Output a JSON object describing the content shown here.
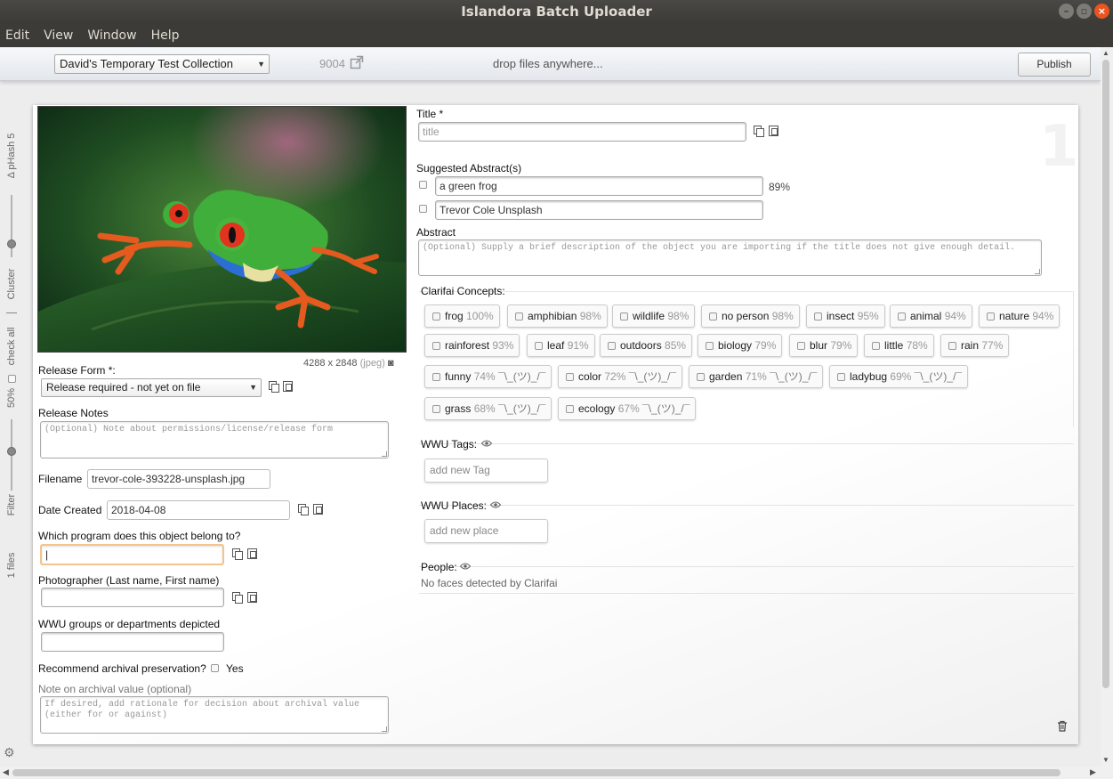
{
  "window": {
    "title": "Islandora Batch Uploader"
  },
  "menu": {
    "items": [
      "Edit",
      "View",
      "Window",
      "Help"
    ]
  },
  "toolbar": {
    "collection": "David's Temporary Test Collection",
    "pid": "9004",
    "drop_hint": "drop files anywhere...",
    "publish_label": "Publish"
  },
  "sidebar": {
    "phash": "Δ pHash 5",
    "cluster": "Cluster",
    "check_all": "check all",
    "percent": "50%",
    "filter": "Filter",
    "files": "1 files"
  },
  "item": {
    "index": "1",
    "image": {
      "dimensions": "4288 x 2848",
      "format": "(jpeg)"
    },
    "release_form": {
      "label": "Release Form *:",
      "value": "Release required - not yet on file"
    },
    "release_notes": {
      "label": "Release Notes",
      "placeholder": "(Optional) Note about permissions/license/release form"
    },
    "filename": {
      "label": "Filename",
      "value": "trevor-cole-393228-unsplash.jpg"
    },
    "date_created": {
      "label": "Date Created",
      "value": "2018-04-08"
    },
    "program": {
      "label": "Which program does this object belong to?",
      "value": ""
    },
    "photographer": {
      "label": "Photographer (Last name, First name)",
      "value": ""
    },
    "groups": {
      "label": "WWU groups or departments depicted",
      "value": ""
    },
    "archival": {
      "label": "Recommend archival preservation?",
      "option": "Yes"
    },
    "archival_note": {
      "label": "Note on archival value (optional)",
      "placeholder": "If desired, add rationale for decision about archival value (either for or against)"
    },
    "title": {
      "label": "Title *",
      "placeholder": "title"
    },
    "suggested_abstracts": {
      "label": "Suggested Abstract(s)",
      "items": [
        {
          "text": "a green frog",
          "confidence": "89%"
        },
        {
          "text": "Trevor Cole Unsplash",
          "confidence": ""
        }
      ]
    },
    "abstract": {
      "label": "Abstract",
      "placeholder": "(Optional) Supply a brief description of the object you are importing if the title does not give enough detail."
    },
    "concepts": {
      "label": "Clarifai Concepts:",
      "items": [
        {
          "name": "frog",
          "pct": "100%",
          "shrug": ""
        },
        {
          "name": "amphibian",
          "pct": "98%",
          "shrug": ""
        },
        {
          "name": "wildlife",
          "pct": "98%",
          "shrug": ""
        },
        {
          "name": "no person",
          "pct": "98%",
          "shrug": ""
        },
        {
          "name": "insect",
          "pct": "95%",
          "shrug": ""
        },
        {
          "name": "animal",
          "pct": "94%",
          "shrug": ""
        },
        {
          "name": "nature",
          "pct": "94%",
          "shrug": ""
        },
        {
          "name": "rainforest",
          "pct": "93%",
          "shrug": ""
        },
        {
          "name": "leaf",
          "pct": "91%",
          "shrug": ""
        },
        {
          "name": "outdoors",
          "pct": "85%",
          "shrug": ""
        },
        {
          "name": "biology",
          "pct": "79%",
          "shrug": ""
        },
        {
          "name": "blur",
          "pct": "79%",
          "shrug": ""
        },
        {
          "name": "little",
          "pct": "78%",
          "shrug": ""
        },
        {
          "name": "rain",
          "pct": "77%",
          "shrug": ""
        },
        {
          "name": "funny",
          "pct": "74%",
          "shrug": "¯\\_(ツ)_/¯"
        },
        {
          "name": "color",
          "pct": "72%",
          "shrug": "¯\\_(ツ)_/¯"
        },
        {
          "name": "garden",
          "pct": "71%",
          "shrug": "¯\\_(ツ)_/¯"
        },
        {
          "name": "ladybug",
          "pct": "69%",
          "shrug": "¯\\_(ツ)_/¯"
        },
        {
          "name": "grass",
          "pct": "68%",
          "shrug": "¯\\_(ツ)_/¯"
        },
        {
          "name": "ecology",
          "pct": "67%",
          "shrug": "¯\\_(ツ)_/¯"
        }
      ]
    },
    "tags": {
      "label": "WWU Tags:",
      "placeholder": "add new Tag"
    },
    "places": {
      "label": "WWU Places:",
      "placeholder": "add new place"
    },
    "people": {
      "label": "People:",
      "message": "No faces detected by Clarifai"
    }
  },
  "icons": {
    "pid_link": "external-link-icon",
    "copy": "copy-icon",
    "paste": "paste-icon",
    "eye": "eye-icon",
    "trash": "trash-icon",
    "camera": "camera-icon",
    "gear": "gear-icon"
  }
}
